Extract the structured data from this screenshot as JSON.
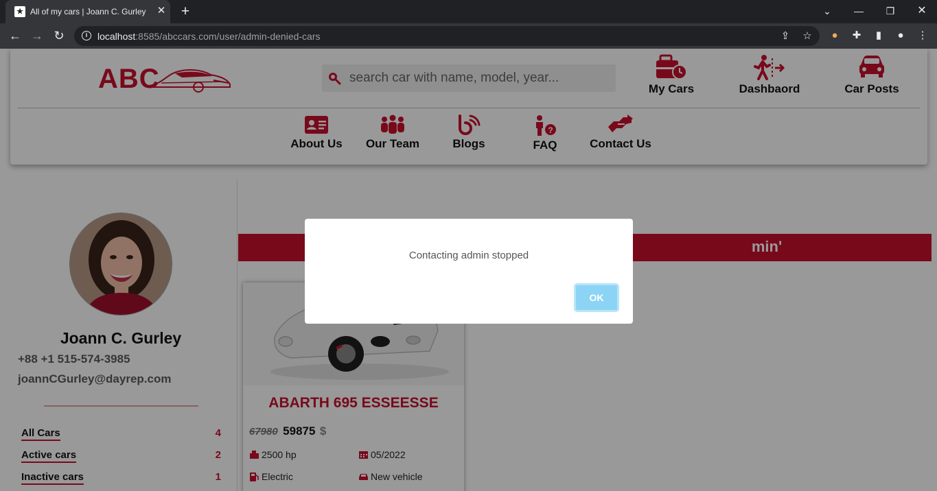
{
  "browser": {
    "tab_title": "All of my cars | Joann C. Gurley",
    "url_host": "localhost",
    "url_path": ":8585/abccars.com/user/admin-denied-cars"
  },
  "site": {
    "logo_text": "ABC",
    "search_placeholder": "search car with name, model, year...",
    "top_links": [
      {
        "label": "My Cars",
        "icon": "briefcase-clock-icon"
      },
      {
        "label": "Dashbaord",
        "icon": "person-exit-icon"
      },
      {
        "label": "Car Posts",
        "icon": "car-icon"
      }
    ],
    "menu": [
      {
        "label": "About Us",
        "icon": "id-card-icon"
      },
      {
        "label": "Our Team",
        "icon": "people-group-icon"
      },
      {
        "label": "Blogs",
        "icon": "blog-icon"
      },
      {
        "label": "FAQ",
        "icon": "person-question-icon"
      },
      {
        "label": "Contact Us",
        "icon": "handshake-icon"
      }
    ],
    "accent_color": "#c8102e"
  },
  "profile": {
    "name": "Joann C. Gurley",
    "phone": "+88 +1 515-574-3985",
    "email": "joannCGurley@dayrep.com",
    "counts": [
      {
        "label": "All Cars",
        "value": "4"
      },
      {
        "label": "Active cars",
        "value": "2"
      },
      {
        "label": "Inactive cars",
        "value": "1"
      }
    ]
  },
  "main": {
    "banner_visible_text": "min'",
    "card": {
      "title": "ABARTH 695 ESSEESSE",
      "old_price": "67980",
      "new_price": "59875",
      "currency": "$",
      "power": "2500 hp",
      "date": "05/2022",
      "fuel": "Electric",
      "condition": "New vehicle"
    }
  },
  "dialog": {
    "message": "Contacting admin stopped",
    "ok_label": "OK"
  }
}
